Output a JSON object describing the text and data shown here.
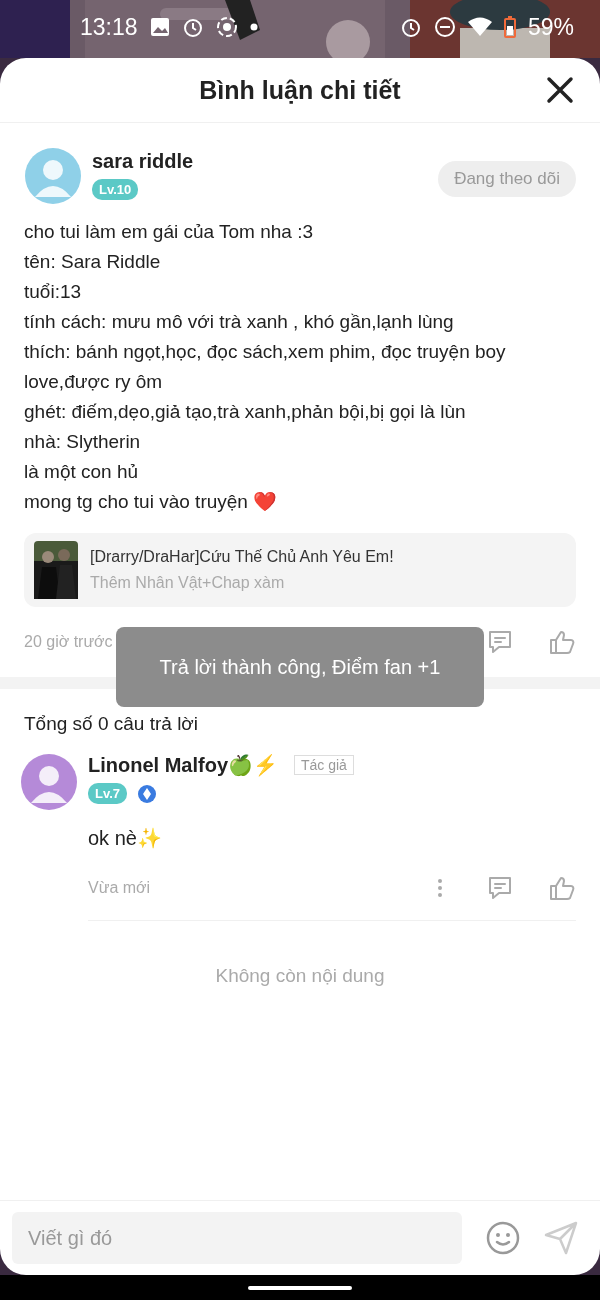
{
  "status_bar": {
    "time": "13:18",
    "battery": "59%"
  },
  "title": "Bình luận chi tiết",
  "comment": {
    "user": "sara riddle",
    "level": "Lv.10",
    "follow_button": "Đang theo dõi",
    "lines": [
      "cho tui làm em gái của Tom nha :3",
      "tên: Sara Riddle",
      "tuổi:13",
      "tính cách: mưu mô với trà xanh , khó gần,lạnh lùng",
      "thích: bánh ngọt,học, đọc sách,xem phim, đọc truyện boy love,được ry ôm",
      "ghét: điếm,dẹo,giả tạo,trà xanh,phản bội,bị gọi là lùn",
      "nhà: Slytherin",
      "là một con hủ",
      "mong tg cho tui vào truyện ❤️"
    ],
    "story": {
      "title": "[Drarry/DraHar]Cứu Thế Chủ Anh Yêu Em!",
      "subtitle": "Thêm Nhân Vật+Chap xàm"
    },
    "time": "20 giờ trước"
  },
  "toast": "Trả lời thành công, Điểm fan +1",
  "replies": {
    "count_label": "Tổng số 0 câu trả lời",
    "items": [
      {
        "name": "Linonel Malfoy🍏⚡",
        "author_tag": "Tác giả",
        "level": "Lv.7",
        "text": "ok nè✨",
        "time": "Vừa mới"
      }
    ]
  },
  "end_label": "Không còn nội dung",
  "input": {
    "placeholder": "Viết gì đó"
  }
}
